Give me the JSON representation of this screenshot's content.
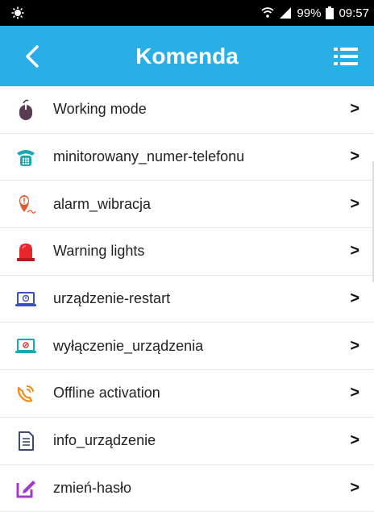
{
  "status": {
    "battery": "99%",
    "time": "09:57"
  },
  "header": {
    "title": "Komenda"
  },
  "colors": {
    "appbar": "#29aee6",
    "statusbar": "#000000"
  },
  "items": [
    {
      "label": "Working mode",
      "icon": "mouse-icon"
    },
    {
      "label": "minitorowany_numer-telefonu",
      "icon": "telephone-icon"
    },
    {
      "label": "alarm_wibracja",
      "icon": "vibration-alarm-icon"
    },
    {
      "label": "Warning lights",
      "icon": "siren-icon"
    },
    {
      "label": "urządzenie-restart",
      "icon": "laptop-restart-icon"
    },
    {
      "label": "wyłączenie_urządzenia",
      "icon": "laptop-shutdown-icon"
    },
    {
      "label": "Offline activation",
      "icon": "phone-call-icon"
    },
    {
      "label": "info_urządzenie",
      "icon": "document-icon"
    },
    {
      "label": "zmień-hasło",
      "icon": "edit-icon"
    }
  ],
  "chevron": ">"
}
